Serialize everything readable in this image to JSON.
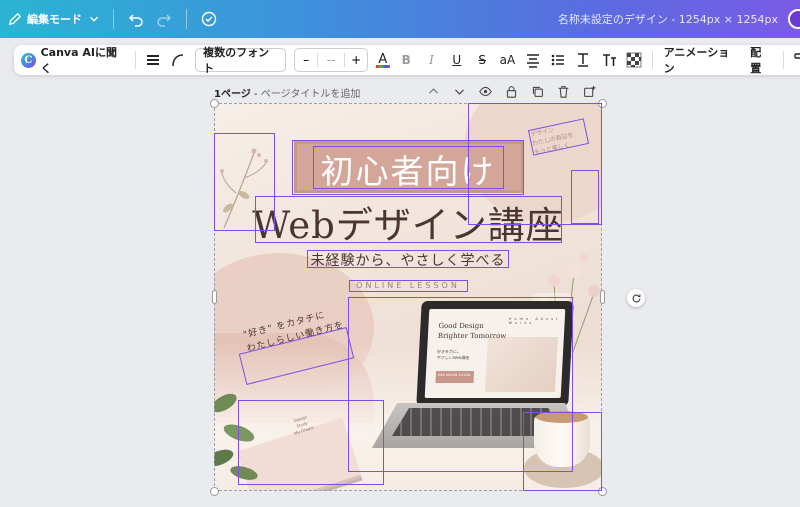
{
  "topbar": {
    "mode_label": "編集モード",
    "doc_title": "名称未設定のデザイン - 1254px × 1254px"
  },
  "toolbar": {
    "ai_label": "Canva AIに聞く",
    "ai_logo": "C",
    "font_label": "複数のフォント",
    "size_minus": "–",
    "size_value": "--",
    "size_plus": "+",
    "color_label": "A",
    "bold_label": "B",
    "italic_label": "I",
    "underline_label": "U",
    "strike_label": "S",
    "case_label": "aA",
    "animation_label": "アニメーション",
    "position_label": "配置"
  },
  "page": {
    "number_label": "1ページ",
    "separator": " - ",
    "title_placeholder": "ページタイトルを追加"
  },
  "design": {
    "title_line1": "初心者向け",
    "title_line2": "Webデザイン講座",
    "subtitle": "未経験から、やさしく学べる",
    "tagline": "ONLINE LESSON",
    "handwriting_line1": "\"好き\" をカタチに",
    "handwriting_line2": "わたしらしい働き方を",
    "corner_note": "デザイン\nわたしの毎日を\nもっと楽しく",
    "laptop_heading_1": "Good Design",
    "laptop_heading_2": "Brighter Tomorrow",
    "laptop_body": "好きを力に。\nやさしいWeb講座",
    "laptop_nav": "Home  About  Works",
    "laptop_button": "WEB DESIGN SCHOOL",
    "notebook_text": "Design\nStudy\nMy Dream"
  },
  "colors": {
    "selection": "#7e4ee8",
    "title_bg": "#d4a69a",
    "text_dark": "#4a3530"
  }
}
